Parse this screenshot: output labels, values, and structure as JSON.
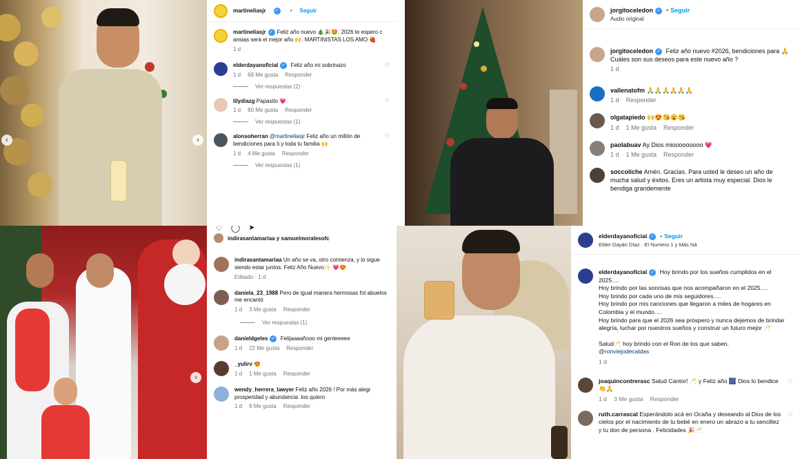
{
  "colors": {
    "accent": "#0095f6",
    "verified": "#3897f0",
    "meta": "#737373",
    "heart": "#ed4956"
  },
  "p1": {
    "header": {
      "username": "martineliasjr",
      "follow": "Seguir"
    },
    "caption": {
      "username": "martineliasjr",
      "text": "Feliz año nuevo 🎄🎉🤩. 2026 te espero c ansias será el mejor año 🙌. MARTINISTAS LOS AMO 🍓",
      "time": "1 d"
    },
    "comments": [
      {
        "username": "elderdayanoficial",
        "verified": true,
        "text": "Feliz año mi sobrinazo",
        "time": "1 d",
        "likes": "68 Me gusta",
        "reply": "Responder",
        "replies": "Ver respuestas (2)"
      },
      {
        "username": "lilydiazg",
        "verified": false,
        "text": "Papasito 💗",
        "time": "1 d",
        "likes": "80 Me gusta",
        "reply": "Responder",
        "replies": "Ver respuestas (1)"
      },
      {
        "username": "alonsoherran",
        "verified": false,
        "mention": "@martineliasjr",
        "text": "Feliz año un millón de bendiciones para ti y toda tu familia 🙌",
        "time": "1 d",
        "likes": "4 Me gusta",
        "reply": "Responder",
        "replies": "Ver respuestas (1)"
      }
    ]
  },
  "p2": {
    "header": {
      "username": "jorgitoceledon",
      "follow": "Seguir",
      "audio": "Audio original"
    },
    "caption": {
      "username": "jorgitoceledon",
      "text": "Feliz año nuevo #2026, bendiciones para 🙏 Cuáles son sus deseos para este nuevo año ?",
      "time": "1 d"
    },
    "comments": [
      {
        "username": "vallenatofm",
        "text": "🙏🙏🙏🙏🙏🙏",
        "time": "1 d",
        "likes": "",
        "reply": "Responder"
      },
      {
        "username": "olgatapiedo",
        "text": "🙌😍😘😮😘",
        "time": "1 d",
        "likes": "1 Me gusta",
        "reply": "Responder"
      },
      {
        "username": "paolabuav",
        "text": "Ay Dios miooooooooo 💗",
        "time": "1 d",
        "likes": "1 Me gusta",
        "reply": "Responder"
      },
      {
        "username": "soccoliche",
        "text": "Amén. Gracias. Para usted le deseo un año de mucha salud y éxitos. Eres un artista muy especial. Dios le bendiga grandemente",
        "time": "",
        "likes": "",
        "reply": ""
      }
    ]
  },
  "p3": {
    "likes_line": "indirasantamariaa y samuelmoralesofc",
    "comments": [
      {
        "username": "indirasantamariaa",
        "text": "Un año se va, otro comienza, y lo sigue siendo estar juntos. Feliz Año Nuevo✨ 💗😍",
        "time": "Editado · 1 d",
        "likes": "",
        "reply": ""
      },
      {
        "username": "daniela_23_1988",
        "text": "Pero de igual manera hermosas fot abuelos me encantó",
        "time": "1 d",
        "likes": "3 Me gusta",
        "reply": "Responder",
        "replies": "Ver respuestas (1)"
      },
      {
        "username": "danieldgeles",
        "verified": true,
        "text": "Felijaaaañooo mi genteeeee",
        "time": "1 d",
        "likes": "22 Me gusta",
        "reply": "Responder"
      },
      {
        "username": "_yulirv",
        "text": "😍",
        "time": "1 d",
        "likes": "1 Me gusta",
        "reply": "Responder"
      },
      {
        "username": "wendy_herrera_lawyer",
        "text": "Feliz año 2026 ! Por más alegr prosperidad y abundancia .los quiero",
        "time": "1 d",
        "likes": "6 Me gusta",
        "reply": "Responder"
      }
    ]
  },
  "p4": {
    "header": {
      "username": "elderdayanoficial",
      "follow": "Seguir",
      "audio": "Elder Dayán Díaz · El Numero 1 y Más Ná"
    },
    "caption": {
      "username": "elderdayanoficial",
      "lines": [
        "Hoy brindo por los sueños cumplidos en el 2025….",
        "Hoy brindo por las sonrisas que nos acompañaron en el 2025….",
        "Hoy brindo por cada uno de mis seguidores….",
        "Hoy brindo por mis canciones que llegaron a miles de hogares en Colombia y el mundo….",
        "Hoy brindo para que el 2026 sea próspero y nunca dejemos de brindar alegría, luchar por nuestros sueños y construir un futuro mejor 🥂",
        "",
        "Salud🥂 hoy brindo con el Ron de los que saben.",
        "@ronviejodecaldas"
      ],
      "time": "1 d"
    },
    "comments": [
      {
        "username": "joaquincontrerasc",
        "text": "Salud Cantor! 🥂 y Feliz año 🎆 Dios lo bendice 👏🙏",
        "time": "1 d",
        "likes": "3 Me gusta",
        "reply": "Responder"
      },
      {
        "username": "ruth.carrascal",
        "text": "Esperándolo acá en Ocaña y deseando al Dios de los cielos por el nacimiento de tu bebé en enero un abrazo a tu sencillez y tu don de persona . Felicidades 🎉🥂",
        "time": "",
        "likes": "",
        "reply": ""
      }
    ]
  },
  "icons": [
    "verified-icon",
    "heart-icon",
    "comment-icon",
    "share-icon",
    "carousel-arrow-icon"
  ]
}
